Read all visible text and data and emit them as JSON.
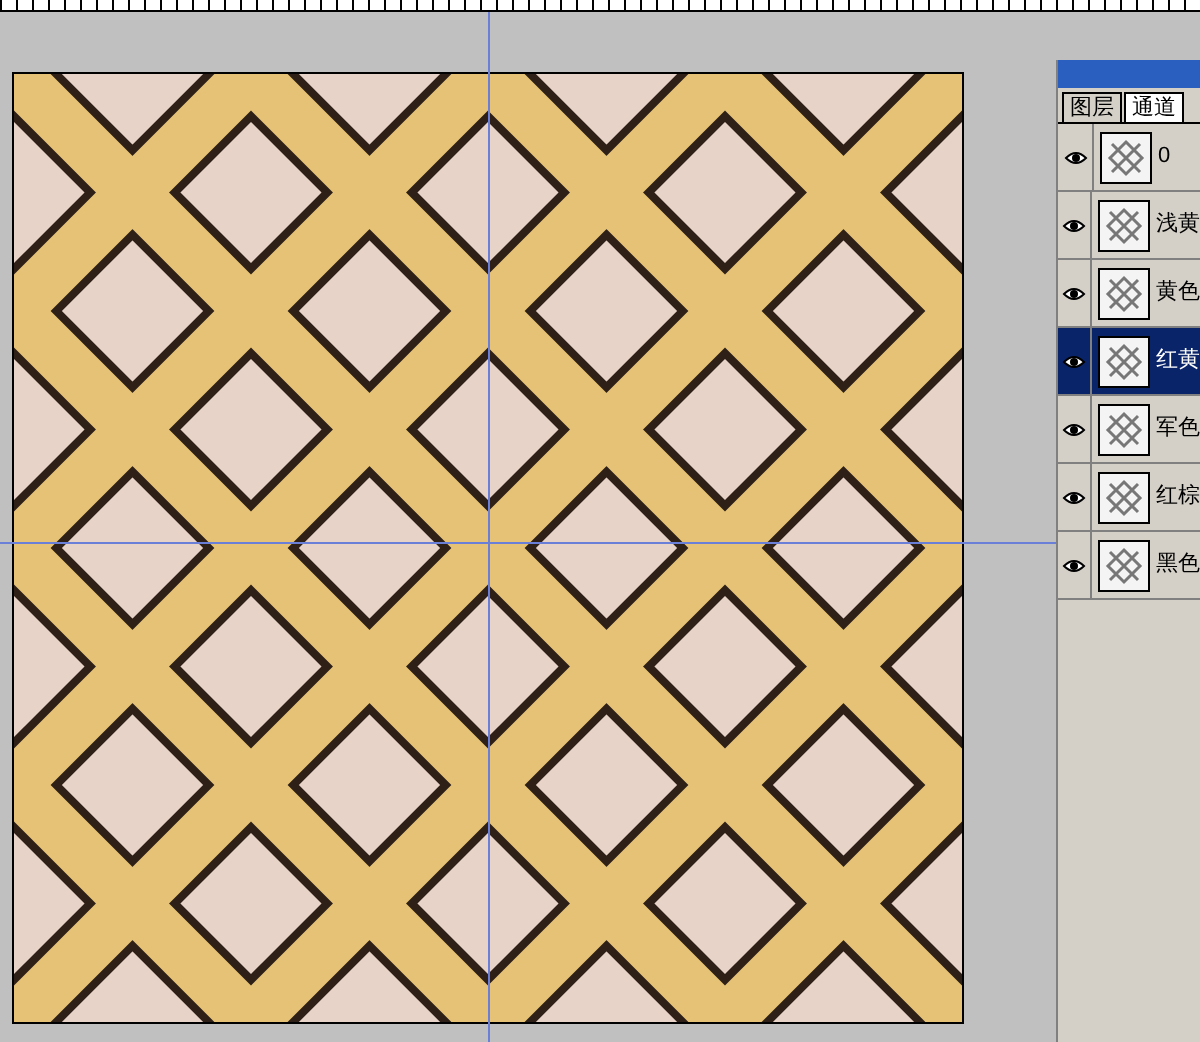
{
  "panel": {
    "tabs": [
      {
        "label": "图层",
        "selected": false
      },
      {
        "label": "通道",
        "selected": true
      }
    ],
    "channels": [
      {
        "name": "0",
        "visible": true,
        "selected": false
      },
      {
        "name": "浅黄",
        "visible": true,
        "selected": false
      },
      {
        "name": "黄色",
        "visible": true,
        "selected": false
      },
      {
        "name": "红黄",
        "visible": true,
        "selected": true
      },
      {
        "name": "军色",
        "visible": true,
        "selected": false
      },
      {
        "name": "红棕",
        "visible": true,
        "selected": false
      },
      {
        "name": "黑色",
        "visible": true,
        "selected": false
      }
    ]
  }
}
